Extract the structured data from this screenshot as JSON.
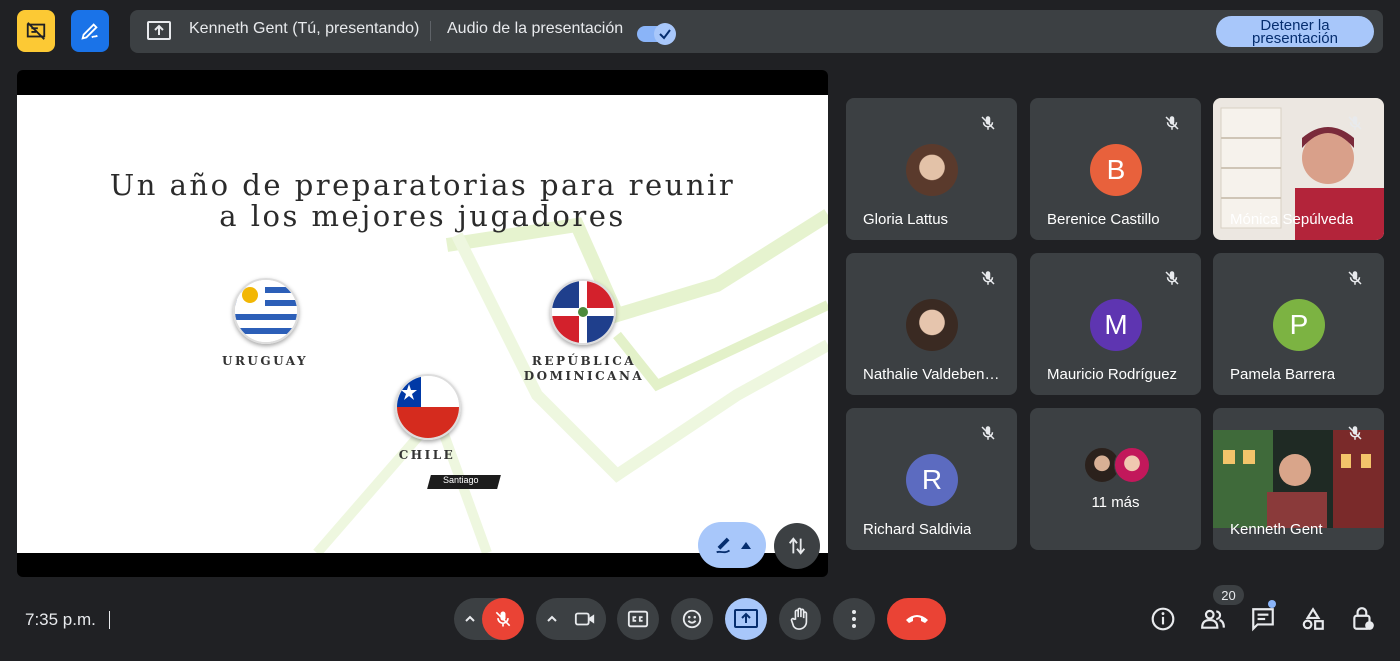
{
  "topbar": {
    "presenter_label": "Kenneth Gent (Tú, presentando)",
    "audio_label": "Audio de la presentación",
    "audio_toggle_on": true,
    "stop_button_line1": "Detener la",
    "stop_button_line2": "presentación"
  },
  "slide": {
    "title_line1": "Un año de preparatorias para reunir",
    "title_line2": "a los mejores jugadores",
    "countries": {
      "uruguay": "URUGUAY",
      "dominicana_line1": "REPÚBLICA",
      "dominicana_line2": "DOMINICANA",
      "chile": "CHILE"
    },
    "tag": "Santiago"
  },
  "participants": [
    {
      "name": "Gloria Lattus",
      "type": "photo"
    },
    {
      "name": "Berenice Castillo",
      "type": "initial",
      "initial": "B",
      "color": "#e8613c"
    },
    {
      "name": "Mónica Sepúlveda",
      "type": "video"
    },
    {
      "name": "Nathalie Valdebenito",
      "display": "Nathalie Valdeben…",
      "type": "photo"
    },
    {
      "name": "Mauricio Rodríguez",
      "type": "initial",
      "initial": "M",
      "color": "#5e35b1"
    },
    {
      "name": "Pamela Barrera",
      "type": "initial",
      "initial": "P",
      "color": "#7cb342"
    },
    {
      "name": "Richard Saldivia",
      "type": "initial",
      "initial": "R",
      "color": "#5c6bc0"
    },
    {
      "name": "11 más",
      "type": "more"
    },
    {
      "name": "Kenneth Gent",
      "type": "video"
    }
  ],
  "bottom": {
    "time": "7:35 p.m.",
    "people_count": "20"
  },
  "colors": {
    "accent": "#a8c7fa",
    "end_call": "#ea4335",
    "yellow_button": "#fbbc04",
    "blue_button": "#1a73e8"
  }
}
